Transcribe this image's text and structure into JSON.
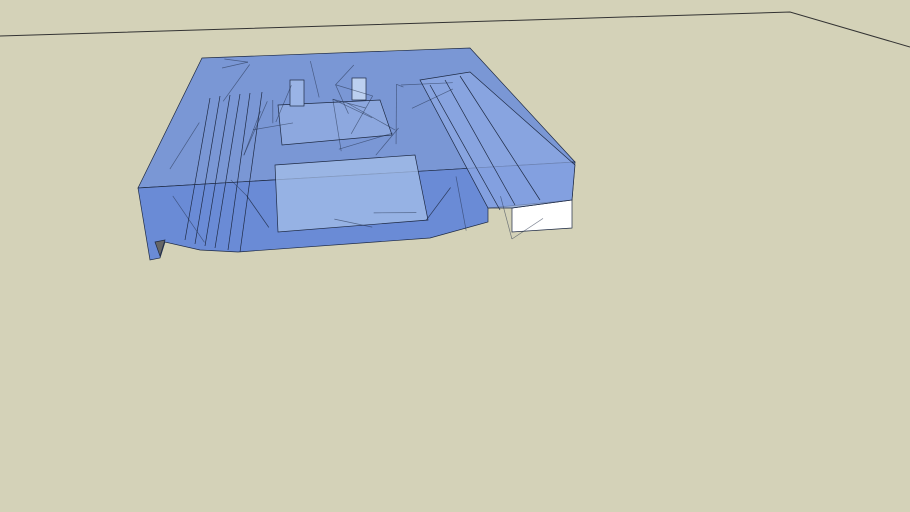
{
  "scene": {
    "ground_color": "#d4d2b8",
    "model_color": "#6d8fd9",
    "model_light_color": "#a9c0ea",
    "edge_color": "#1e2a44",
    "white_face_color": "#ffffff"
  }
}
